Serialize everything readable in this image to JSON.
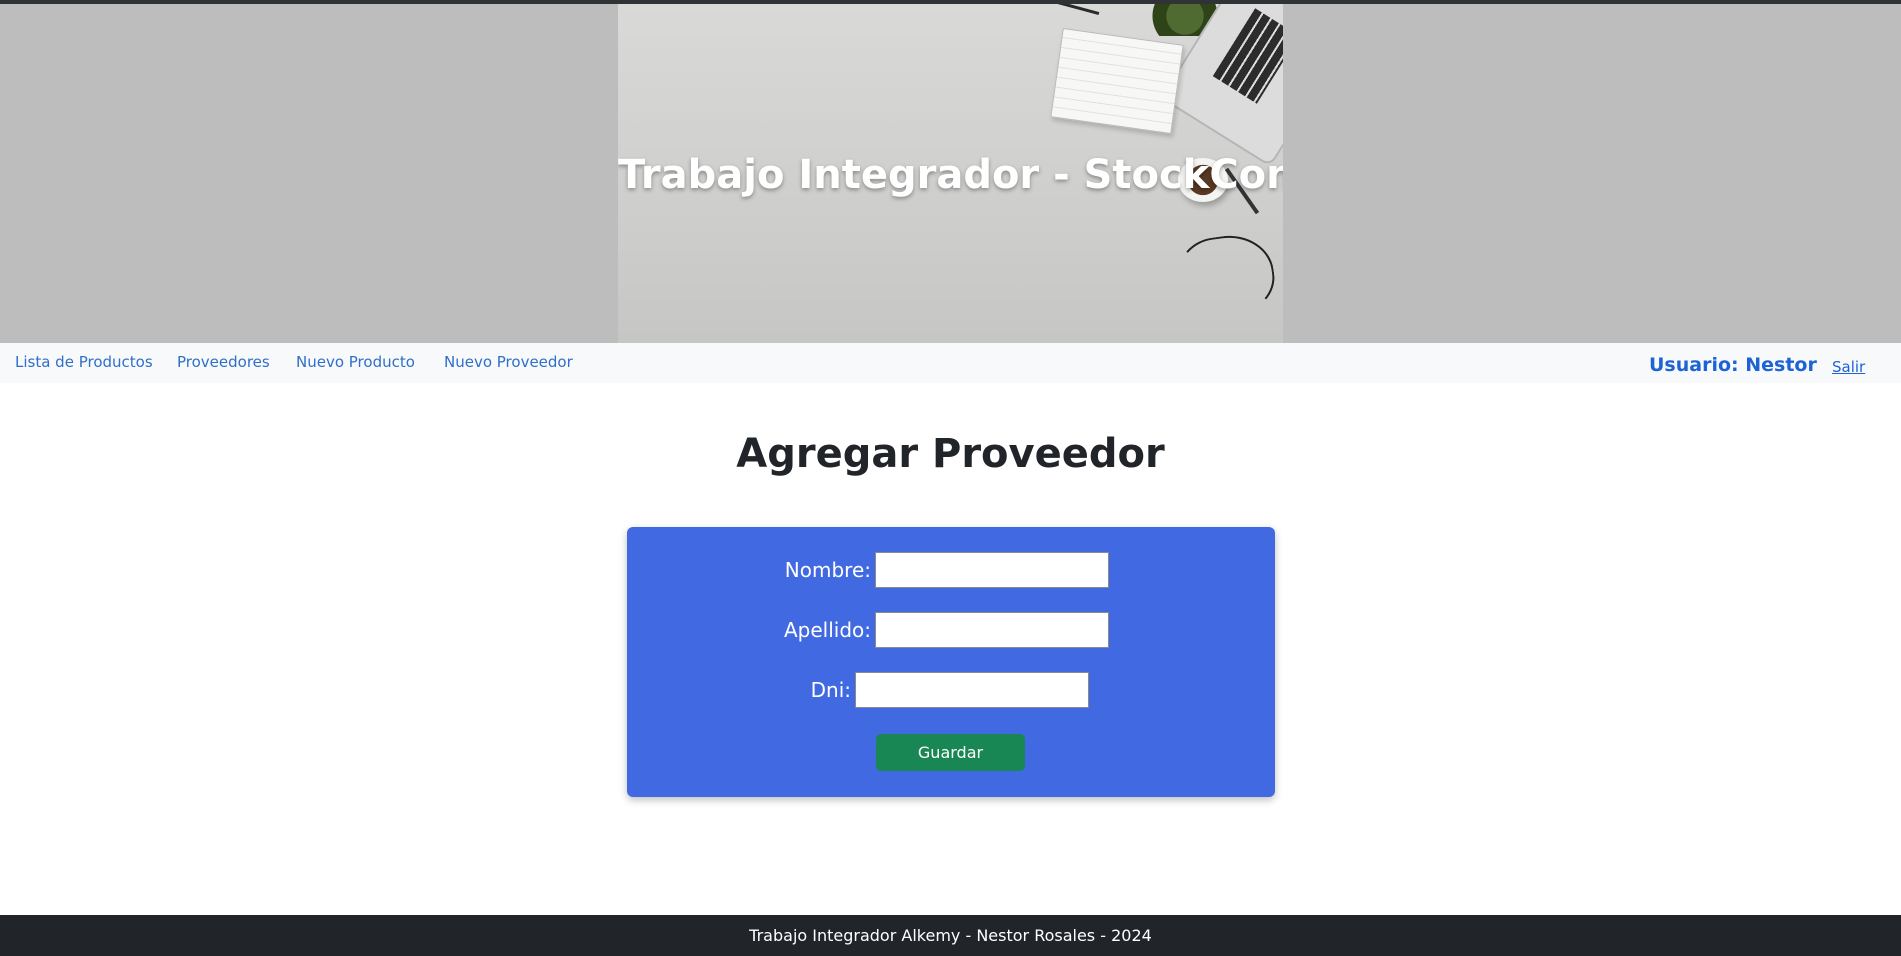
{
  "header": {
    "title": "Trabajo Integrador - StockControl"
  },
  "nav": {
    "links": [
      {
        "label": "Lista de Productos"
      },
      {
        "label": "Proveedores"
      },
      {
        "label": "Nuevo Producto"
      },
      {
        "label": "Nuevo Proveedor"
      }
    ],
    "user_label": "Usuario: Nestor",
    "logout_label": "Salir"
  },
  "main": {
    "title": "Agregar Proveedor",
    "form": {
      "fields": [
        {
          "label": "Nombre:",
          "value": ""
        },
        {
          "label": "Apellido:",
          "value": ""
        },
        {
          "label": "Dni:",
          "value": ""
        }
      ],
      "submit_label": "Guardar"
    }
  },
  "footer": {
    "text": "Trabajo Integrador Alkemy - Nestor Rosales - 2024"
  },
  "colors": {
    "header_bg": "#bcbdbc",
    "nav_bg": "#f8f9fa",
    "link": "#2f6fc9",
    "form_bg": "#4169e1",
    "button_bg": "#198754",
    "footer_bg": "#212529"
  }
}
